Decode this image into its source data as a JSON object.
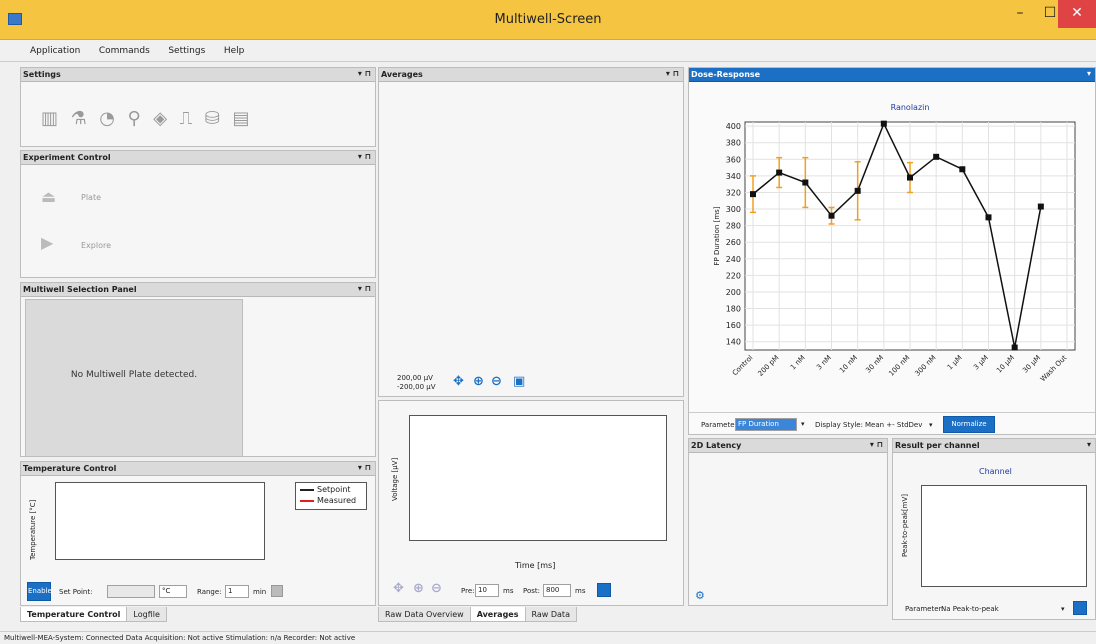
{
  "window": {
    "title": "Multiwell-Screen"
  },
  "menu": [
    "Application",
    "Commands",
    "Settings",
    "Help"
  ],
  "panels": {
    "settings": "Settings",
    "experiment": "Experiment Control",
    "multiwell": "Multiwell Selection Panel",
    "temperature": "Temperature Control",
    "averages": "Averages",
    "dose_response": "Dose-Response",
    "latency": "2D Latency",
    "result": "Result per channel"
  },
  "experiment": {
    "plate": "Plate",
    "explore": "Explore"
  },
  "multiwell": {
    "message": "No Multiwell Plate detected."
  },
  "temperature": {
    "ylabel": "Temperature [°C]",
    "legend": {
      "setpoint": "Setpoint",
      "measured": "Measured",
      "setpoint_color": "#222222",
      "measured_color": "#e02020"
    },
    "enable": "Enable",
    "set_point_label": "Set Point:",
    "unit": "°C",
    "range_label": "Range:",
    "range_value": "1",
    "range_unit": "min"
  },
  "averages": {
    "scale_top": "200,00 µV",
    "scale_bottom": "-200,00 µV"
  },
  "raw": {
    "ylabel": "Voltage [µV]",
    "xlabel": "Time [ms]",
    "pre_label": "Pre:",
    "pre_value": "10",
    "post_label": "Post:",
    "post_value": "800",
    "ms": "ms"
  },
  "tabs_left": [
    "Temperature Control",
    "Logfile"
  ],
  "tabs_mid": [
    "Raw Data Overview",
    "Averages",
    "Raw Data"
  ],
  "dose_controls": {
    "parameter_label": "Parameter:",
    "parameter_value": "FP Duration",
    "display_label": "Display Style:",
    "display_value": "Mean +- StdDev",
    "normalize": "Normalize"
  },
  "result": {
    "title": "Channel",
    "ylabel": "Peak-to-peak[mV]",
    "parameter_label": "Parameter:",
    "parameter_value": "Na Peak-to-peak"
  },
  "statusbar": "Multiwell-MEA-System: Connected  Data Acquisition: Not active  Stimulation: n/a  Recorder: Not active",
  "chart_data": {
    "type": "line",
    "title": "Ranolazin",
    "xlabel": "",
    "ylabel": "FP Duration [ms]",
    "categories": [
      "Control",
      "200 pM",
      "1 nM",
      "3 nM",
      "10 nM",
      "30 nM",
      "100 nM",
      "300 nM",
      "1 µM",
      "3 µM",
      "10 µM",
      "30 µM",
      "Wash Out"
    ],
    "values": [
      318,
      344,
      332,
      292,
      322,
      403,
      338,
      363,
      348,
      290,
      133,
      303
    ],
    "errors": [
      22,
      18,
      30,
      10,
      35,
      0,
      18,
      0,
      0,
      0,
      0,
      0
    ],
    "ylim": [
      130,
      405
    ],
    "yticks": [
      140,
      160,
      180,
      200,
      220,
      240,
      260,
      280,
      300,
      320,
      340,
      360,
      380,
      400
    ],
    "grid": true,
    "line_color": "#111111",
    "error_color": "#f0a020"
  }
}
